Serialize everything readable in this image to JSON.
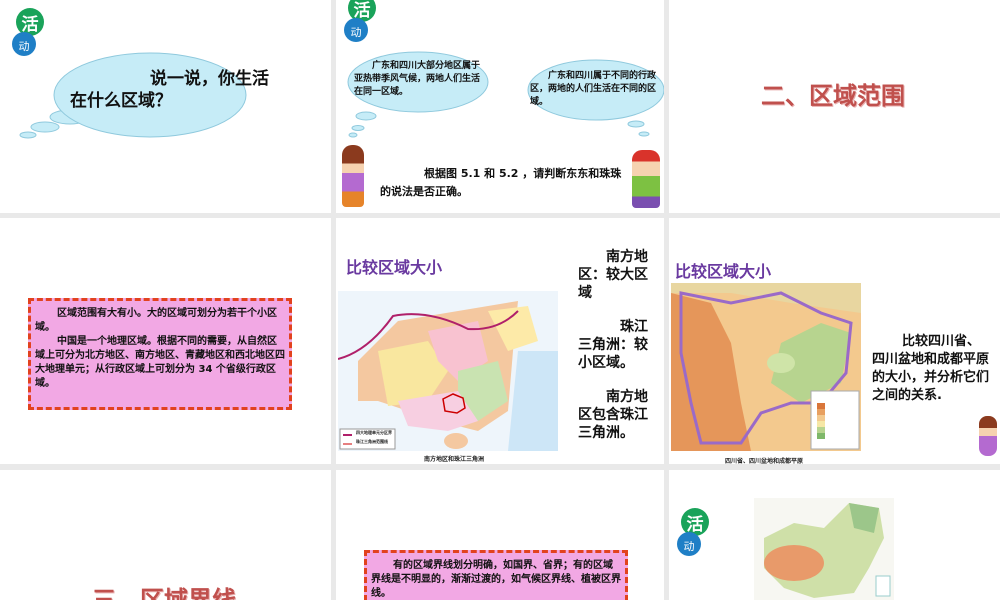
{
  "activity_badge": {
    "top": "活",
    "bottom": "动"
  },
  "slides": [
    {
      "cloud_text": "说一说，你生活在什么区域？"
    },
    {
      "cloud_left": "广东和四川大部分地区属于亚热带季风气候，两地人们生活在同一区域。",
      "cloud_right": "广东和四川属于不同的行政区，两地的人们生活在不同的区域。",
      "prompt": "根据图 5.1 和 5.2 ，请判断东东和珠珠的说法是否正确。"
    },
    {
      "title": "二、区域范围"
    },
    {
      "paragraph1": "区域范围有大有小。大的区域可划分为若干个小区域。",
      "paragraph2": "中国是一个地理区域。根据不同的需要，从自然区域上可分为北方地区、南方地区、青藏地区和西北地区四大地理单元；从行政区域上可划分为 34 个省级行政区域。"
    },
    {
      "title": "比较区域大小",
      "map_caption": "南方地区和珠江三角洲",
      "legend": [
        "四大地理单元分区界",
        "珠江三角洲范围线"
      ],
      "notes": [
        "南方地区：较大区域",
        "珠江三角洲：较小区域。",
        "南方地区包含珠江三角洲。"
      ]
    },
    {
      "title": "比较区域大小",
      "map_caption": "四川省、四川盆地和成都平原",
      "question": "比较四川省、四川盆地和成都平原的大小，并分析它们之间的关系."
    },
    {
      "title": "三、区域界线"
    },
    {
      "paragraph": "有的区域界线划分明确，如国界、省界；有的区域界线是不明显的，渐渐过渡的，如气候区界线、植被区界线。"
    },
    {}
  ]
}
